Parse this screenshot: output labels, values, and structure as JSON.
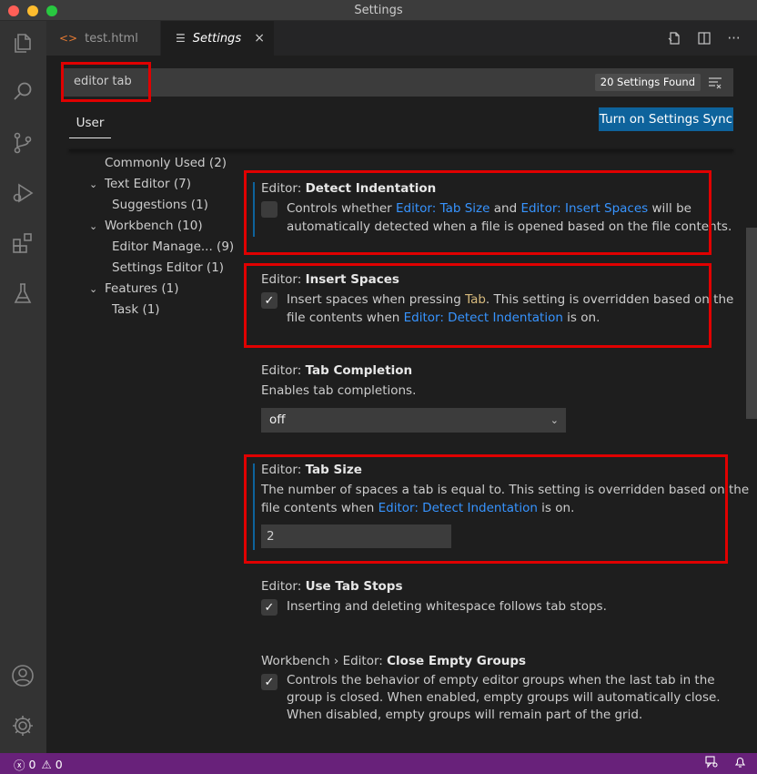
{
  "window": {
    "title": "Settings"
  },
  "tabs": [
    {
      "label": "test.html",
      "icon": "html-code-icon"
    },
    {
      "label": "Settings",
      "icon": "settings-lines-icon",
      "close": "×"
    }
  ],
  "editor_actions": [
    "open-json-icon",
    "split-editor-icon",
    "more-actions-icon"
  ],
  "search": {
    "value": "editor tab",
    "found": "20 Settings Found"
  },
  "scope_tab": "User",
  "sync_button": "Turn on Settings Sync",
  "toc": [
    {
      "label": "Commonly Used",
      "count": "(2)"
    },
    {
      "label": "Text Editor",
      "count": "(7)"
    },
    {
      "label": "Suggestions",
      "count": "(1)"
    },
    {
      "label": "Workbench",
      "count": "(10)"
    },
    {
      "label": "Editor Manage...",
      "count": "(9)"
    },
    {
      "label": "Settings Editor",
      "count": "(1)"
    },
    {
      "label": "Features",
      "count": "(1)"
    },
    {
      "label": "Task",
      "count": "(1)"
    }
  ],
  "settings": {
    "detect_indentation": {
      "category": "Editor: ",
      "name": "Detect Indentation",
      "desc_1": "Controls whether ",
      "link_1": "Editor: Tab Size",
      "desc_2": " and ",
      "link_2": "Editor: Insert Spaces",
      "desc_3": " will be",
      "desc_line2": "automatically detected when a file is opened based on the file contents.",
      "checked": false
    },
    "insert_spaces": {
      "category": "Editor: ",
      "name": "Insert Spaces",
      "desc_1": "Insert spaces when pressing ",
      "code": "Tab",
      "desc_2": ". This setting is overridden based on the",
      "desc_line2_1": "file contents when ",
      "link": "Editor: Detect Indentation",
      "desc_line2_2": " is on.",
      "checked": true
    },
    "tab_completion": {
      "category": "Editor: ",
      "name": "Tab Completion",
      "desc": "Enables tab completions.",
      "value": "off"
    },
    "tab_size": {
      "category": "Editor: ",
      "name": "Tab Size",
      "desc_line1": "The number of spaces a tab is equal to. This setting is overridden based on the",
      "desc_line2_1": "file contents when ",
      "link": "Editor: Detect Indentation",
      "desc_line2_2": " is on.",
      "value": "2"
    },
    "use_tab_stops": {
      "category": "Editor: ",
      "name": "Use Tab Stops",
      "desc": "Inserting and deleting whitespace follows tab stops.",
      "checked": true
    },
    "close_empty_groups": {
      "category": "Workbench › Editor: ",
      "name": "Close Empty Groups",
      "desc_line1": "Controls the behavior of empty editor groups when the last tab in the",
      "desc_line2": "group is closed. When enabled, empty groups will automatically close.",
      "desc_line3": "When disabled, empty groups will remain part of the grid.",
      "checked": true
    }
  },
  "status": {
    "errors": "0",
    "warnings": "0"
  },
  "colors": {
    "accent": "#0e639c",
    "status_bar": "#68217a",
    "highlight": "#e00000",
    "link": "#3794ff"
  }
}
